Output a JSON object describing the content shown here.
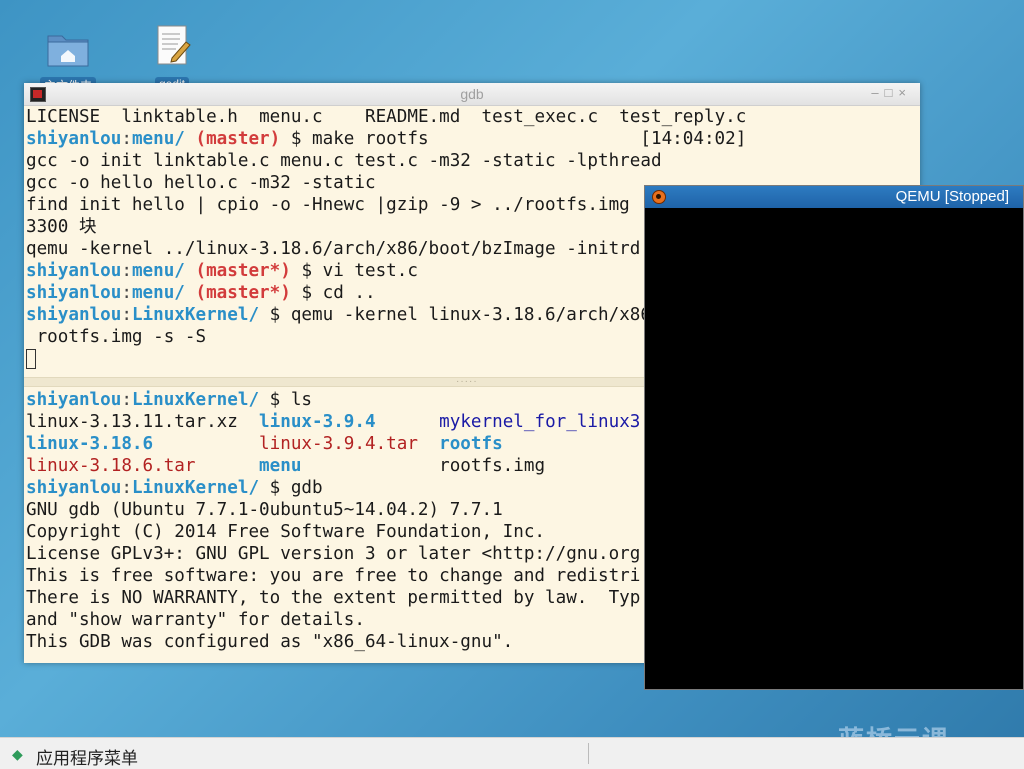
{
  "desktop": {
    "icons": [
      {
        "label": "主文件夹",
        "icon": "home-folder-icon"
      },
      {
        "label": "gedit",
        "icon": "text-editor-icon"
      }
    ]
  },
  "terminal": {
    "title": "gdb",
    "controls": {
      "minimize": "–",
      "maximize": "□",
      "close": "×"
    },
    "pane1": {
      "ls_files": [
        "LICENSE",
        "linktable.h",
        "menu.c",
        "README.md",
        "test_exec.c",
        "test_reply.c"
      ],
      "prompt1": {
        "user": "shiyanlou",
        "path": "menu/",
        "branch": "(master)",
        "cmd": "$ make rootfs",
        "time": "[14:04:02]"
      },
      "line_gcc1": "gcc -o init linktable.c menu.c test.c -m32 -static -lpthread",
      "line_gcc2": "gcc -o hello hello.c -m32 -static",
      "line_find": "find init hello | cpio -o -Hnewc |gzip -9 > ../rootfs.img",
      "line_blocks": "3300 块",
      "line_qemu": "qemu -kernel ../linux-3.18.6/arch/x86/boot/bzImage -initrd",
      "prompt2": {
        "user": "shiyanlou",
        "path": "menu/",
        "branch": "(master*)",
        "cmd": "$ vi test.c"
      },
      "prompt3": {
        "user": "shiyanlou",
        "path": "menu/",
        "branch": "(master*)",
        "cmd": "$ cd .."
      },
      "prompt4": {
        "user": "shiyanlou",
        "path": "LinuxKernel/",
        "cmd": "$ qemu -kernel linux-3.18.6/arch/x86"
      },
      "line_cont": " rootfs.img -s -S"
    },
    "splitter_dots": "·····",
    "pane2": {
      "prompt_ls": {
        "user": "shiyanlou",
        "path": "LinuxKernel/",
        "cmd": "$ ls"
      },
      "ls_rows": [
        [
          "linux-3.13.11.tar.xz",
          "linux-3.9.4",
          "mykernel_for_linux3"
        ],
        [
          "linux-3.18.6",
          "linux-3.9.4.tar",
          "rootfs"
        ],
        [
          "linux-3.18.6.tar",
          "menu",
          "rootfs.img"
        ]
      ],
      "prompt_gdb": {
        "user": "shiyanlou",
        "path": "LinuxKernel/",
        "cmd": "$ gdb"
      },
      "gdb_lines": [
        "GNU gdb (Ubuntu 7.7.1-0ubuntu5~14.04.2) 7.7.1",
        "Copyright (C) 2014 Free Software Foundation, Inc.",
        "License GPLv3+: GNU GPL version 3 or later <http://gnu.org",
        "This is free software: you are free to change and redistri",
        "There is NO WARRANTY, to the extent permitted by law.  Typ",
        "and \"show warranty\" for details.",
        "This GDB was configured as \"x86_64-linux-gnu\"."
      ]
    }
  },
  "qemu": {
    "title": "QEMU [Stopped]"
  },
  "taskbar": {
    "menu_label": "应用程序菜单"
  },
  "watermark": "蓝桥云课"
}
